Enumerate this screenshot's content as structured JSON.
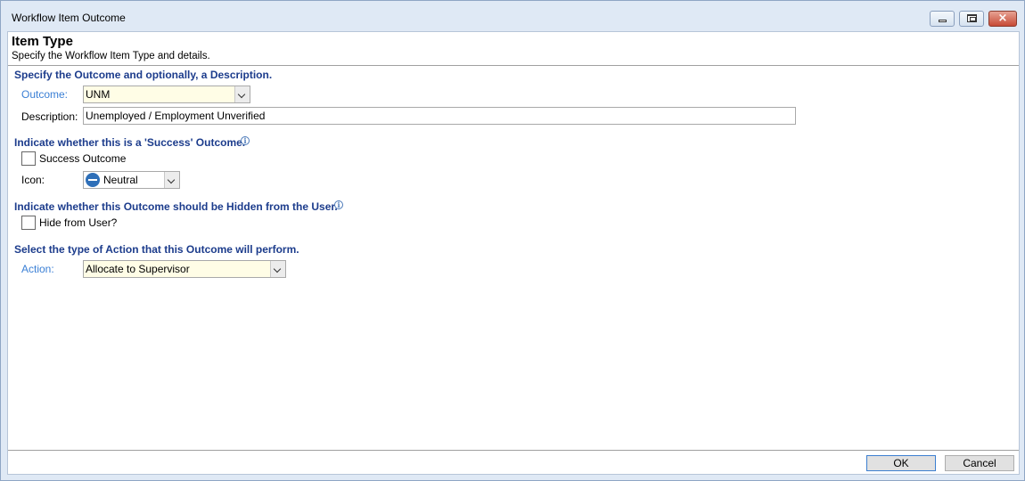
{
  "window": {
    "title": "Workflow Item Outcome",
    "close_glyph": "×"
  },
  "header": {
    "title": "Item Type",
    "subtitle": "Specify the Workflow Item Type and details."
  },
  "outcome_section": {
    "heading": "Specify the Outcome and optionally, a Description.",
    "outcome_label": "Outcome:",
    "outcome_value": "UNM",
    "description_label": "Description:",
    "description_value": "Unemployed / Employment Unverified"
  },
  "success_section": {
    "heading": "Indicate whether this is a 'Success' Outcome.",
    "checkbox_label": "Success Outcome",
    "checkbox_checked": false,
    "icon_label": "Icon:",
    "icon_value": "Neutral"
  },
  "hidden_section": {
    "heading": "Indicate whether this Outcome should be Hidden from the User.",
    "checkbox_label": "Hide from User?",
    "checkbox_checked": false
  },
  "action_section": {
    "heading": "Select the type of Action that this Outcome will perform.",
    "action_label": "Action:",
    "action_value": "Allocate to Supervisor"
  },
  "footer": {
    "ok_label": "OK",
    "cancel_label": "Cancel"
  },
  "colors": {
    "section_heading": "#1c3c8c",
    "required_label": "#3a7fd5",
    "combo_fill": "#fffde6",
    "window_frame": "#dfe9f5"
  },
  "info_glyph": "i"
}
